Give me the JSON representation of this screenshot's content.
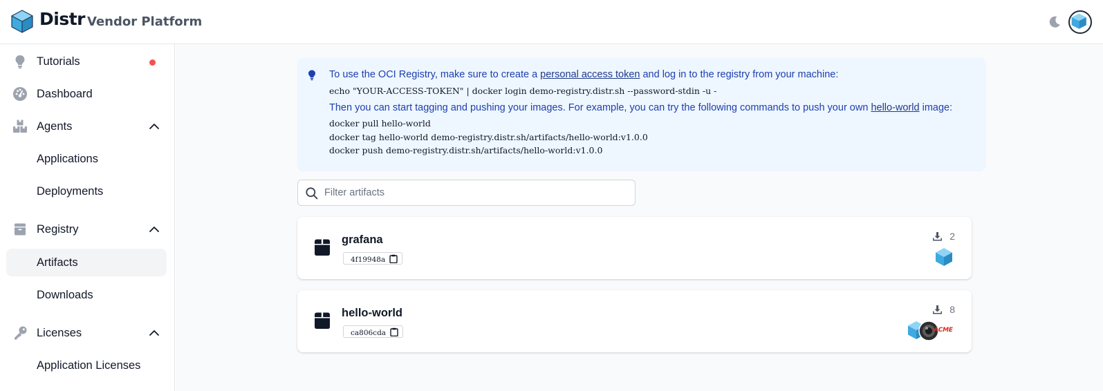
{
  "header": {
    "brand": "Distr",
    "subtitle": "Vendor Platform"
  },
  "sidebar": {
    "items": [
      {
        "label": "Tutorials",
        "icon": "lightbulb-icon",
        "badge": "notification-dot"
      },
      {
        "label": "Dashboard",
        "icon": "gauge-icon"
      },
      {
        "label": "Agents",
        "icon": "boxes-icon",
        "expanded": true
      },
      {
        "label": "Applications"
      },
      {
        "label": "Deployments"
      },
      {
        "label": "Registry",
        "icon": "box-archive-icon",
        "expanded": true
      },
      {
        "label": "Artifacts",
        "active": true
      },
      {
        "label": "Downloads"
      },
      {
        "label": "Licenses",
        "icon": "key-icon",
        "expanded": true
      },
      {
        "label": "Application Licenses"
      }
    ]
  },
  "info": {
    "line1_prefix": "To use the OCI Registry, make sure to create a ",
    "line1_link": "personal access token",
    "line1_suffix": " and log in to the registry from your machine:",
    "code1": "echo \"YOUR-ACCESS-TOKEN\" | docker login demo-registry.distr.sh --password-stdin -u -",
    "line2_prefix": "Then you can start tagging and pushing your images. For example, you can try the following commands to push your own ",
    "line2_link": "hello-world",
    "line2_suffix": " image:",
    "code2": "docker pull hello-world",
    "code3": "docker tag hello-world demo-registry.distr.sh/artifacts/hello-world:v1.0.0",
    "code4": "docker push demo-registry.distr.sh/artifacts/hello-world:v1.0.0"
  },
  "search": {
    "placeholder": "Filter artifacts",
    "value": ""
  },
  "artifacts": [
    {
      "name": "grafana",
      "digest": "4f19948a",
      "downloads": "2",
      "vendors": [
        "distr-cube"
      ]
    },
    {
      "name": "hello-world",
      "digest": "ca806cda",
      "downloads": "8",
      "vendors": [
        "distr-cube",
        "dark-avatar",
        "acme-logo"
      ]
    }
  ],
  "logo_text": {
    "acme": "ACME"
  },
  "colors": {
    "accent": "#1e40af",
    "info_bg": "#eef6ff",
    "notification": "#f05252",
    "cube": "#4fb3e8"
  }
}
